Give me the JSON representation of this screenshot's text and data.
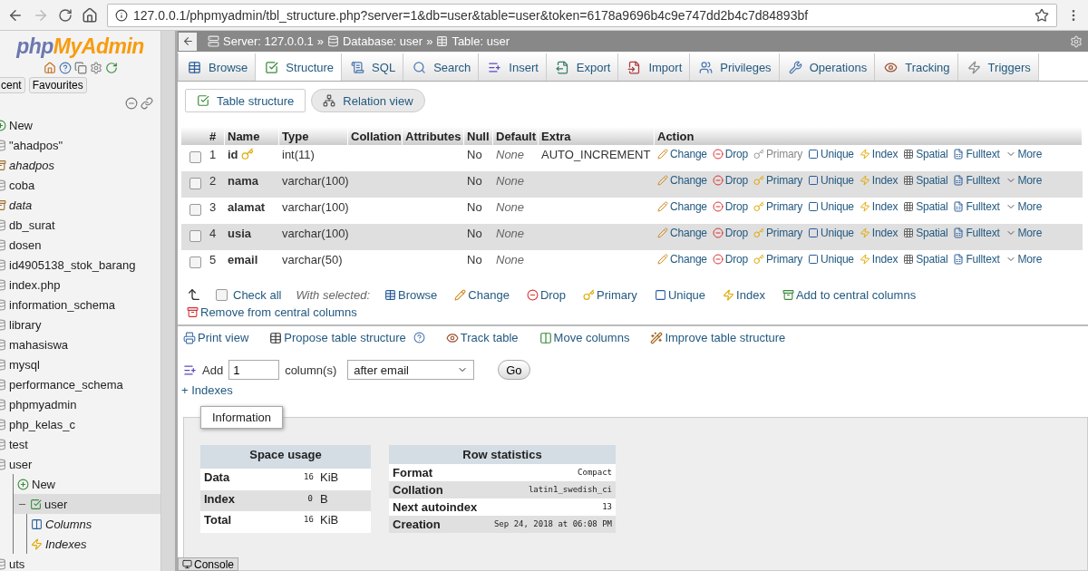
{
  "browser": {
    "url": "127.0.0.1/phpmyadmin/tbl_structure.php?server=1&db=user&table=user&token=6178a9696b4c9e747dd2b4c7d84893bf"
  },
  "sidebar": {
    "logo": {
      "php": "php",
      "myadmin": "MyAdmin"
    },
    "tabs": [
      {
        "label": "cent",
        "selected": false
      },
      {
        "label": "Favourites",
        "selected": false
      }
    ],
    "tree": [
      {
        "kind": "new",
        "label": "New",
        "selected": false
      },
      {
        "kind": "db",
        "label": "\"ahadpos\"",
        "selected": false
      },
      {
        "kind": "view",
        "label": "ahadpos",
        "selected": false
      },
      {
        "kind": "db",
        "label": "coba",
        "selected": false
      },
      {
        "kind": "view",
        "label": "data",
        "selected": false
      },
      {
        "kind": "db",
        "label": "db_surat",
        "selected": false
      },
      {
        "kind": "db",
        "label": "dosen",
        "selected": false
      },
      {
        "kind": "db",
        "label": "id4905138_stok_barang",
        "selected": false
      },
      {
        "kind": "db",
        "label": "index.php",
        "selected": false
      },
      {
        "kind": "db",
        "label": "information_schema",
        "selected": false
      },
      {
        "kind": "db",
        "label": "library",
        "selected": false
      },
      {
        "kind": "db",
        "label": "mahasiswa",
        "selected": false
      },
      {
        "kind": "db",
        "label": "mysql",
        "selected": false
      },
      {
        "kind": "db",
        "label": "performance_schema",
        "selected": false
      },
      {
        "kind": "db",
        "label": "phpmyadmin",
        "selected": false
      },
      {
        "kind": "db",
        "label": "php_kelas_c",
        "selected": false
      },
      {
        "kind": "db",
        "label": "test",
        "selected": false
      },
      {
        "kind": "db",
        "label": "user",
        "selected": false,
        "children": [
          {
            "kind": "new-table",
            "label": "New",
            "selected": false
          },
          {
            "kind": "table",
            "label": "user",
            "selected": true,
            "children": [
              {
                "kind": "columns",
                "label": "Columns",
                "selected": false
              },
              {
                "kind": "indexes",
                "label": "Indexes",
                "selected": false
              }
            ]
          }
        ]
      },
      {
        "kind": "db",
        "label": "uts",
        "selected": false
      }
    ]
  },
  "breadcrumb": [
    {
      "kind": "server",
      "label": "Server: 127.0.0.1",
      "separator": "»"
    },
    {
      "kind": "database",
      "label": "Database: user",
      "separator": "»"
    },
    {
      "kind": "table",
      "label": "Table: user"
    }
  ],
  "tabs": [
    {
      "label": "Browse",
      "selected": false
    },
    {
      "label": "Structure",
      "selected": true
    },
    {
      "label": "SQL",
      "selected": false
    },
    {
      "label": "Search",
      "selected": false
    },
    {
      "label": "Insert",
      "selected": false
    },
    {
      "label": "Export",
      "selected": false
    },
    {
      "label": "Import",
      "selected": false
    },
    {
      "label": "Privileges",
      "selected": false
    },
    {
      "label": "Operations",
      "selected": false
    },
    {
      "label": "Tracking",
      "selected": false
    },
    {
      "label": "Triggers",
      "selected": false
    }
  ],
  "subtabs": [
    {
      "label": "Table structure",
      "selected": true
    },
    {
      "label": "Relation view",
      "selected": false
    }
  ],
  "table": {
    "columns": [
      "#",
      "Name",
      "Type",
      "Collation",
      "Attributes",
      "Null",
      "Default",
      "Extra",
      "Action"
    ],
    "rows": [
      {
        "checked": false,
        "num": "1",
        "name": "id",
        "primary_key": true,
        "type": "int(11)",
        "null": "No",
        "default": "None",
        "extra": "AUTO_INCREMENT",
        "actions": [
          {
            "kind": "change",
            "label": "Change",
            "disabled": false
          },
          {
            "kind": "drop",
            "label": "Drop",
            "disabled": false
          },
          {
            "kind": "primary",
            "label": "Primary",
            "disabled": true
          },
          {
            "kind": "unique",
            "label": "Unique",
            "disabled": false
          },
          {
            "kind": "index",
            "label": "Index",
            "disabled": false
          },
          {
            "kind": "spatial",
            "label": "Spatial",
            "disabled": false
          },
          {
            "kind": "fulltext",
            "label": "Fulltext",
            "disabled": false
          },
          {
            "kind": "more",
            "label": "More",
            "disabled": false
          }
        ]
      },
      {
        "checked": false,
        "num": "2",
        "name": "nama",
        "primary_key": false,
        "type": "varchar(100)",
        "null": "No",
        "default": "None",
        "actions": [
          {
            "kind": "change",
            "label": "Change",
            "disabled": false
          },
          {
            "kind": "drop",
            "label": "Drop",
            "disabled": false
          },
          {
            "kind": "primary",
            "label": "Primary",
            "disabled": false
          },
          {
            "kind": "unique",
            "label": "Unique",
            "disabled": false
          },
          {
            "kind": "index",
            "label": "Index",
            "disabled": false
          },
          {
            "kind": "spatial",
            "label": "Spatial",
            "disabled": false
          },
          {
            "kind": "fulltext",
            "label": "Fulltext",
            "disabled": false
          },
          {
            "kind": "more",
            "label": "More",
            "disabled": false
          }
        ]
      },
      {
        "checked": false,
        "num": "3",
        "name": "alamat",
        "primary_key": false,
        "type": "varchar(100)",
        "null": "No",
        "default": "None",
        "actions": [
          {
            "kind": "change",
            "label": "Change",
            "disabled": false
          },
          {
            "kind": "drop",
            "label": "Drop",
            "disabled": false
          },
          {
            "kind": "primary",
            "label": "Primary",
            "disabled": false
          },
          {
            "kind": "unique",
            "label": "Unique",
            "disabled": false
          },
          {
            "kind": "index",
            "label": "Index",
            "disabled": false
          },
          {
            "kind": "spatial",
            "label": "Spatial",
            "disabled": false
          },
          {
            "kind": "fulltext",
            "label": "Fulltext",
            "disabled": false
          },
          {
            "kind": "more",
            "label": "More",
            "disabled": false
          }
        ]
      },
      {
        "checked": false,
        "num": "4",
        "name": "usia",
        "primary_key": false,
        "type": "varchar(100)",
        "null": "No",
        "default": "None",
        "actions": [
          {
            "kind": "change",
            "label": "Change",
            "disabled": false
          },
          {
            "kind": "drop",
            "label": "Drop",
            "disabled": false
          },
          {
            "kind": "primary",
            "label": "Primary",
            "disabled": false
          },
          {
            "kind": "unique",
            "label": "Unique",
            "disabled": false
          },
          {
            "kind": "index",
            "label": "Index",
            "disabled": false
          },
          {
            "kind": "spatial",
            "label": "Spatial",
            "disabled": false
          },
          {
            "kind": "fulltext",
            "label": "Fulltext",
            "disabled": false
          },
          {
            "kind": "more",
            "label": "More",
            "disabled": false
          }
        ]
      },
      {
        "checked": false,
        "num": "5",
        "name": "email",
        "primary_key": false,
        "type": "varchar(50)",
        "null": "No",
        "default": "None",
        "actions": [
          {
            "kind": "change",
            "label": "Change",
            "disabled": false
          },
          {
            "kind": "drop",
            "label": "Drop",
            "disabled": false
          },
          {
            "kind": "primary",
            "label": "Primary",
            "disabled": false
          },
          {
            "kind": "unique",
            "label": "Unique",
            "disabled": false
          },
          {
            "kind": "index",
            "label": "Index",
            "disabled": false
          },
          {
            "kind": "spatial",
            "label": "Spatial",
            "disabled": false
          },
          {
            "kind": "fulltext",
            "label": "Fulltext",
            "disabled": false
          },
          {
            "kind": "more",
            "label": "More",
            "disabled": false
          }
        ]
      }
    ]
  },
  "bulk": {
    "check_all": {
      "label": "Check all",
      "checked": false
    },
    "with_selected": "With selected:",
    "actions": [
      {
        "kind": "browse",
        "label": "Browse"
      },
      {
        "kind": "change",
        "label": "Change"
      },
      {
        "kind": "drop",
        "label": "Drop"
      },
      {
        "kind": "primary",
        "label": "Primary"
      },
      {
        "kind": "unique",
        "label": "Unique"
      },
      {
        "kind": "index",
        "label": "Index"
      },
      {
        "kind": "central-add",
        "label": "Add to central columns"
      },
      {
        "kind": "central-remove",
        "label": "Remove from central columns"
      }
    ]
  },
  "toolbar": [
    {
      "kind": "print",
      "label": "Print view"
    },
    {
      "kind": "propose",
      "label": "Propose table structure"
    },
    {
      "kind": "track",
      "label": "Track table"
    },
    {
      "kind": "move",
      "label": "Move columns"
    },
    {
      "kind": "improve",
      "label": "Improve table structure"
    }
  ],
  "add_columns": {
    "label": "Add",
    "value": "1",
    "unit": "column(s)",
    "position": "after email",
    "button": "Go"
  },
  "indexes_link": "+ Indexes",
  "information": {
    "legend": "Information",
    "space_usage": {
      "title": "Space usage",
      "rows": [
        {
          "label": "Data",
          "value": "16",
          "unit": "KiB"
        },
        {
          "label": "Index",
          "value": "0",
          "unit": "B"
        },
        {
          "label": "Total",
          "value": "16",
          "unit": "KiB"
        }
      ]
    },
    "row_statistics": {
      "title": "Row statistics",
      "rows": [
        {
          "label": "Format",
          "value": "Compact"
        },
        {
          "label": "Collation",
          "value": "latin1_swedish_ci"
        },
        {
          "label": "Next autoindex",
          "value": "13"
        },
        {
          "label": "Creation",
          "value": "Sep 24, 2018 at 06:08 PM"
        }
      ]
    }
  },
  "console": "Console"
}
